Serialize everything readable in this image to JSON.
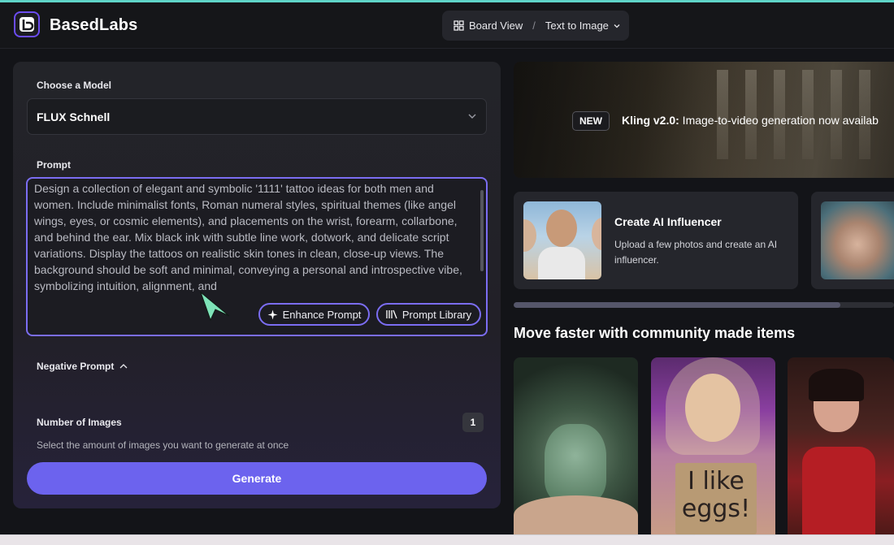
{
  "header": {
    "brand": "BasedLabs",
    "breadcrumb": {
      "board_view": "Board View",
      "separator": "/",
      "current": "Text to Image"
    }
  },
  "form": {
    "model_label": "Choose a Model",
    "model_value": "FLUX Schnell",
    "prompt_label": "Prompt",
    "prompt_text": "Design a collection of elegant and symbolic '1111' tattoo ideas for both men and women. Include minimalist fonts, Roman numeral styles, spiritual themes (like angel wings, eyes, or cosmic elements), and placements on the wrist, forearm, collarbone, and behind the ear. Mix black ink with subtle line work, dotwork, and delicate script variations. Display the tattoos on realistic skin tones in clean, close-up views. The background should be soft and minimal, conveying a personal and introspective vibe, symbolizing intuition, alignment, and",
    "enhance_label": "Enhance Prompt",
    "library_label": "Prompt Library",
    "negative_label": "Negative Prompt",
    "num_images_label": "Number of Images",
    "num_images_value": "1",
    "num_images_helper": "Select the amount of images you want to generate at once",
    "generate_label": "Generate"
  },
  "banner": {
    "badge": "NEW",
    "headline_bold": "Kling v2.0:",
    "headline_rest": " Image-to-video generation now availab"
  },
  "cards": [
    {
      "title": "Create AI Influencer",
      "description": "Upload a few photos and create an AI influencer."
    }
  ],
  "carousel": {
    "progress": 0.86
  },
  "community": {
    "title": "Move faster with community made items",
    "sign_text": "I like eggs!"
  },
  "colors": {
    "accent": "#6c63ee",
    "focus_border": "#7b6df2",
    "background": "#131418"
  }
}
